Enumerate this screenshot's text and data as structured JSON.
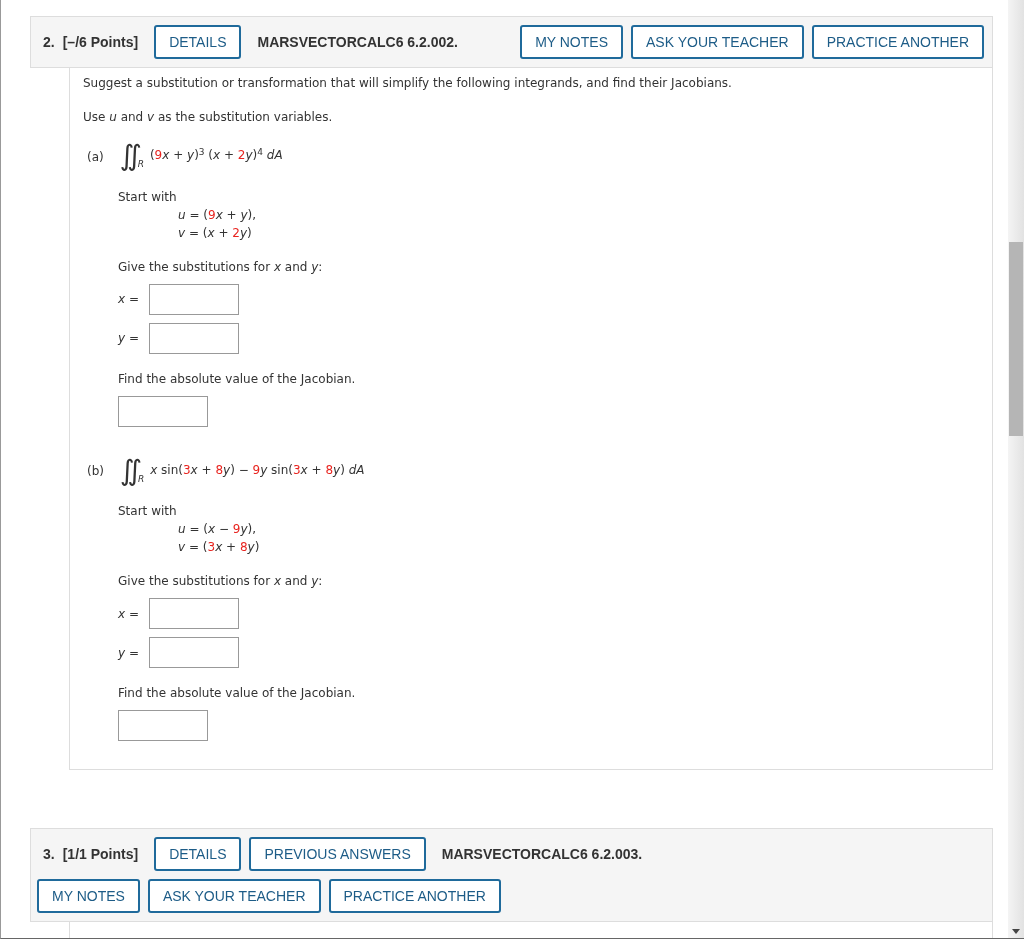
{
  "questions": [
    {
      "number": "2.",
      "points": "[–/6 Points]",
      "header_items": [
        {
          "kind": "button",
          "text": "DETAILS"
        },
        {
          "kind": "code",
          "text": "MARSVECTORCALC6 6.2.002."
        },
        {
          "kind": "button",
          "text": "MY NOTES"
        },
        {
          "kind": "button",
          "text": "ASK YOUR TEACHER"
        },
        {
          "kind": "button",
          "text": "PRACTICE ANOTHER"
        }
      ],
      "intro": "Suggest a substitution or transformation that will simplify the following integrands, and find their Jacobians.",
      "instruction": "Use *u* and *v* as the substitution variables.",
      "parts": [
        {
          "label": "(a)",
          "integral": [
            {
              "kind": "op",
              "text": "∬"
            },
            {
              "kind": "sub",
              "text": "R"
            },
            {
              "kind": "text",
              "text": " ("
            },
            {
              "kind": "num",
              "text": "9"
            },
            {
              "kind": "var",
              "text": "x"
            },
            {
              "kind": "text",
              "text": " + "
            },
            {
              "kind": "var",
              "text": "y"
            },
            {
              "kind": "text",
              "text": ")"
            },
            {
              "kind": "sup",
              "text": "3"
            },
            {
              "kind": "text",
              "text": " ("
            },
            {
              "kind": "var",
              "text": "x"
            },
            {
              "kind": "text",
              "text": " + "
            },
            {
              "kind": "num",
              "text": "2"
            },
            {
              "kind": "var",
              "text": "y"
            },
            {
              "kind": "text",
              "text": ")"
            },
            {
              "kind": "sup",
              "text": "4"
            },
            {
              "kind": "var",
              "text": " dA"
            }
          ],
          "start_label": "Start with",
          "start_lines": [
            [
              {
                "kind": "var",
                "text": "u"
              },
              {
                "kind": "text",
                "text": " = ("
              },
              {
                "kind": "num",
                "text": "9"
              },
              {
                "kind": "var",
                "text": "x"
              },
              {
                "kind": "text",
                "text": " + "
              },
              {
                "kind": "var",
                "text": "y"
              },
              {
                "kind": "text",
                "text": "),"
              }
            ],
            [
              {
                "kind": "var",
                "text": "v"
              },
              {
                "kind": "text",
                "text": " = ("
              },
              {
                "kind": "var",
                "text": "x"
              },
              {
                "kind": "text",
                "text": " + "
              },
              {
                "kind": "num",
                "text": "2"
              },
              {
                "kind": "var",
                "text": "y"
              },
              {
                "kind": "text",
                "text": ")"
              }
            ]
          ],
          "substitution_prompt": "Give the substitutions for *x* and *y*:",
          "fields": [
            {
              "label": "*x* ="
            },
            {
              "label": "*y* ="
            }
          ],
          "jacobian_prompt": "Find the absolute value of the Jacobian."
        },
        {
          "label": "(b)",
          "integral": [
            {
              "kind": "op",
              "text": "∬"
            },
            {
              "kind": "sub",
              "text": "R"
            },
            {
              "kind": "var",
              "text": " x"
            },
            {
              "kind": "text",
              "text": " sin("
            },
            {
              "kind": "num",
              "text": "3"
            },
            {
              "kind": "var",
              "text": "x"
            },
            {
              "kind": "text",
              "text": " + "
            },
            {
              "kind": "num",
              "text": "8"
            },
            {
              "kind": "var",
              "text": "y"
            },
            {
              "kind": "text",
              "text": ") − "
            },
            {
              "kind": "num",
              "text": "9"
            },
            {
              "kind": "var",
              "text": "y"
            },
            {
              "kind": "text",
              "text": " sin("
            },
            {
              "kind": "num",
              "text": "3"
            },
            {
              "kind": "var",
              "text": "x"
            },
            {
              "kind": "text",
              "text": " + "
            },
            {
              "kind": "num",
              "text": "8"
            },
            {
              "kind": "var",
              "text": "y"
            },
            {
              "kind": "text",
              "text": ") "
            },
            {
              "kind": "var",
              "text": "dA"
            }
          ],
          "start_label": "Start with",
          "start_lines": [
            [
              {
                "kind": "var",
                "text": "u"
              },
              {
                "kind": "text",
                "text": " = ("
              },
              {
                "kind": "var",
                "text": "x"
              },
              {
                "kind": "text",
                "text": " − "
              },
              {
                "kind": "num",
                "text": "9"
              },
              {
                "kind": "var",
                "text": "y"
              },
              {
                "kind": "text",
                "text": "),"
              }
            ],
            [
              {
                "kind": "var",
                "text": "v"
              },
              {
                "kind": "text",
                "text": " = ("
              },
              {
                "kind": "num",
                "text": "3"
              },
              {
                "kind": "var",
                "text": "x"
              },
              {
                "kind": "text",
                "text": " + "
              },
              {
                "kind": "num",
                "text": "8"
              },
              {
                "kind": "var",
                "text": "y"
              },
              {
                "kind": "text",
                "text": ")"
              }
            ]
          ],
          "substitution_prompt": "Give the substitutions for *x* and *y*:",
          "fields": [
            {
              "label": "*x* ="
            },
            {
              "label": "*y* ="
            }
          ],
          "jacobian_prompt": "Find the absolute value of the Jacobian."
        }
      ]
    },
    {
      "number": "3.",
      "points": "[1/1 Points]",
      "header_items": [
        {
          "kind": "button",
          "text": "DETAILS"
        },
        {
          "kind": "button",
          "text": "PREVIOUS ANSWERS"
        },
        {
          "kind": "code",
          "text": "MARSVECTORCALC6 6.2.003."
        }
      ],
      "second_row_buttons": [
        "MY NOTES",
        "ASK YOUR TEACHER",
        "PRACTICE ANOTHER"
      ]
    }
  ]
}
